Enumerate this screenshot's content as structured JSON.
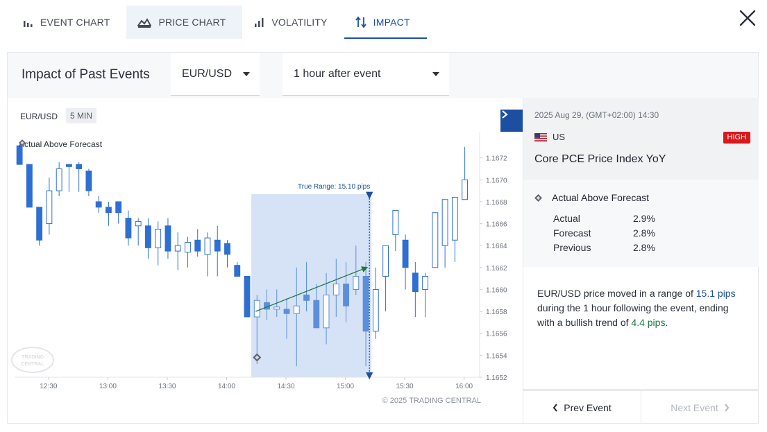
{
  "tabs": [
    {
      "label": "EVENT CHART",
      "icon": "bar-chart-icon"
    },
    {
      "label": "PRICE CHART",
      "icon": "mountain-chart-icon"
    },
    {
      "label": "VOLATILITY",
      "icon": "volatility-bars-icon"
    },
    {
      "label": "IMPACT",
      "icon": "up-down-arrows-icon",
      "active": true
    }
  ],
  "header": {
    "title": "Impact of Past Events",
    "symbol_select": "EUR/USD",
    "period_select": "1 hour after event"
  },
  "chart": {
    "symbol": "EUR/USD",
    "timeframe": "5 MIN",
    "legend": "Actual Above Forecast",
    "range_label": "True Range: 15.10 pips",
    "copyright": "© 2025 TRADING CENTRAL",
    "watermark": "TRADING CENTRAL",
    "colors": {
      "bull": "#2e6fd3",
      "bear": "#2e6fd3",
      "range_fill": "#d6e2f5",
      "trend": "#1a7a3f"
    }
  },
  "chart_data": {
    "type": "candlestick",
    "y_ticks": [
      1.1652,
      1.1654,
      1.1656,
      1.1658,
      1.166,
      1.1662,
      1.1664,
      1.1666,
      1.1668,
      1.167,
      1.1672
    ],
    "ylim": [
      1.1652,
      1.1674
    ],
    "x_ticks": [
      "12:30",
      "13:00",
      "13:30",
      "14:00",
      "14:30",
      "15:00",
      "15:30",
      "16:00"
    ],
    "grid": false,
    "event_time": "14:30",
    "range_window": [
      "14:30",
      "15:30"
    ],
    "true_range_pips": 15.1,
    "trend_pips": 4.4,
    "candles": [
      {
        "t": 0,
        "o": 1.16731,
        "h": 1.16731,
        "l": 1.16714,
        "c": 1.16714
      },
      {
        "t": 1,
        "o": 1.16714,
        "h": 1.16714,
        "l": 1.16675,
        "c": 1.16675
      },
      {
        "t": 2,
        "o": 1.16675,
        "h": 1.16675,
        "l": 1.1664,
        "c": 1.16645
      },
      {
        "t": 3,
        "o": 1.1666,
        "h": 1.16702,
        "l": 1.1665,
        "c": 1.1669
      },
      {
        "t": 4,
        "o": 1.1669,
        "h": 1.16716,
        "l": 1.16685,
        "c": 1.1671
      },
      {
        "t": 5,
        "o": 1.16714,
        "h": 1.16714,
        "l": 1.16689,
        "c": 1.16712
      },
      {
        "t": 6,
        "o": 1.16714,
        "h": 1.16716,
        "l": 1.16689,
        "c": 1.1671
      },
      {
        "t": 7,
        "o": 1.16708,
        "h": 1.1671,
        "l": 1.16685,
        "c": 1.1669
      },
      {
        "t": 8,
        "o": 1.1668,
        "h": 1.16685,
        "l": 1.1667,
        "c": 1.16675
      },
      {
        "t": 9,
        "o": 1.16675,
        "h": 1.1668,
        "l": 1.16658,
        "c": 1.1667
      },
      {
        "t": 10,
        "o": 1.1668,
        "h": 1.1668,
        "l": 1.1666,
        "c": 1.1667
      },
      {
        "t": 11,
        "o": 1.16665,
        "h": 1.16672,
        "l": 1.1664,
        "c": 1.16647
      },
      {
        "t": 12,
        "o": 1.16658,
        "h": 1.16665,
        "l": 1.1664,
        "c": 1.16662
      },
      {
        "t": 13,
        "o": 1.16658,
        "h": 1.16665,
        "l": 1.16628,
        "c": 1.16638
      },
      {
        "t": 14,
        "o": 1.16638,
        "h": 1.16662,
        "l": 1.16622,
        "c": 1.16655
      },
      {
        "t": 15,
        "o": 1.16658,
        "h": 1.16665,
        "l": 1.16628,
        "c": 1.16635
      },
      {
        "t": 16,
        "o": 1.16635,
        "h": 1.16652,
        "l": 1.16618,
        "c": 1.1664
      },
      {
        "t": 17,
        "o": 1.16634,
        "h": 1.16648,
        "l": 1.1662,
        "c": 1.16643
      },
      {
        "t": 18,
        "o": 1.16645,
        "h": 1.16655,
        "l": 1.1663,
        "c": 1.16635
      },
      {
        "t": 19,
        "o": 1.16632,
        "h": 1.16652,
        "l": 1.16612,
        "c": 1.16647
      },
      {
        "t": 20,
        "o": 1.16645,
        "h": 1.16658,
        "l": 1.16612,
        "c": 1.16635
      },
      {
        "t": 21,
        "o": 1.16642,
        "h": 1.16645,
        "l": 1.1662,
        "c": 1.16632
      },
      {
        "t": 22,
        "o": 1.16622,
        "h": 1.16625,
        "l": 1.16612,
        "c": 1.16612
      },
      {
        "t": 23,
        "o": 1.16612,
        "h": 1.16612,
        "l": 1.16575,
        "c": 1.16575
      },
      {
        "t": 24,
        "o": 1.16575,
        "h": 1.16595,
        "l": 1.16532,
        "c": 1.1659
      },
      {
        "t": 25,
        "o": 1.16588,
        "h": 1.166,
        "l": 1.16572,
        "c": 1.16582
      },
      {
        "t": 26,
        "o": 1.16582,
        "h": 1.166,
        "l": 1.16575,
        "c": 1.16584
      },
      {
        "t": 27,
        "o": 1.16582,
        "h": 1.16592,
        "l": 1.16555,
        "c": 1.16578
      },
      {
        "t": 28,
        "o": 1.16578,
        "h": 1.1662,
        "l": 1.1653,
        "c": 1.16585
      },
      {
        "t": 29,
        "o": 1.16595,
        "h": 1.16625,
        "l": 1.1658,
        "c": 1.1659
      },
      {
        "t": 30,
        "o": 1.1659,
        "h": 1.16605,
        "l": 1.1657,
        "c": 1.16565
      },
      {
        "t": 31,
        "o": 1.16565,
        "h": 1.16615,
        "l": 1.1655,
        "c": 1.16595
      },
      {
        "t": 32,
        "o": 1.16595,
        "h": 1.16628,
        "l": 1.16575,
        "c": 1.16605
      },
      {
        "t": 33,
        "o": 1.16605,
        "h": 1.16625,
        "l": 1.1657,
        "c": 1.16585
      },
      {
        "t": 34,
        "o": 1.166,
        "h": 1.1664,
        "l": 1.16595,
        "c": 1.16612
      },
      {
        "t": 35,
        "o": 1.16612,
        "h": 1.16625,
        "l": 1.1653,
        "c": 1.16562
      },
      {
        "t": 36,
        "o": 1.16562,
        "h": 1.1662,
        "l": 1.16555,
        "c": 1.166
      },
      {
        "t": 37,
        "o": 1.16612,
        "h": 1.1664,
        "l": 1.1658,
        "c": 1.1664
      },
      {
        "t": 38,
        "o": 1.1665,
        "h": 1.16672,
        "l": 1.16635,
        "c": 1.16672
      },
      {
        "t": 39,
        "o": 1.16645,
        "h": 1.1665,
        "l": 1.166,
        "c": 1.1662
      },
      {
        "t": 40,
        "o": 1.16615,
        "h": 1.16625,
        "l": 1.16575,
        "c": 1.16598
      },
      {
        "t": 41,
        "o": 1.166,
        "h": 1.16615,
        "l": 1.16575,
        "c": 1.16612
      },
      {
        "t": 42,
        "o": 1.1662,
        "h": 1.1667,
        "l": 1.1662,
        "c": 1.1667
      },
      {
        "t": 43,
        "o": 1.1664,
        "h": 1.1667,
        "l": 1.1662,
        "c": 1.16682
      },
      {
        "t": 44,
        "o": 1.16645,
        "h": 1.16678,
        "l": 1.16625,
        "c": 1.16684
      },
      {
        "t": 45,
        "o": 1.16682,
        "h": 1.1673,
        "l": 1.16682,
        "c": 1.167
      }
    ]
  },
  "event": {
    "datetime": "2025 Aug 29, (GMT+02:00) 14:30",
    "country": "US",
    "impact": "HIGH",
    "name": "Core PCE Price Index YoY",
    "outcome": "Actual Above Forecast",
    "values": [
      {
        "label": "Actual",
        "value": "2.9%"
      },
      {
        "label": "Forecast",
        "value": "2.8%"
      },
      {
        "label": "Previous",
        "value": "2.8%"
      }
    ],
    "summary": {
      "p1": "EUR/USD price moved in a range of ",
      "range": "15.1 pips",
      "p2": " during the 1 hour following the event, ending with a bullish trend of ",
      "trend": "4.4 pips",
      "p3": "."
    }
  },
  "nav": {
    "prev": "Prev Event",
    "next": "Next Event"
  }
}
